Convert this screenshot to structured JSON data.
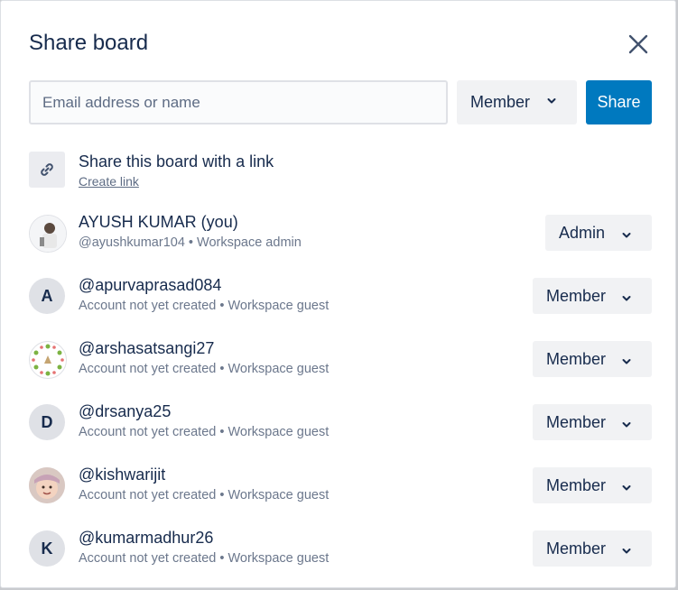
{
  "dialog": {
    "title": "Share board",
    "email_placeholder": "Email address or name",
    "role_default": "Member",
    "share_label": "Share"
  },
  "link_section": {
    "title": "Share this board with a link",
    "create_link_label": "Create link"
  },
  "members": [
    {
      "name": "AYUSH KUMAR (you)",
      "subtitle": "@ayushkumar104 • Workspace admin",
      "role": "Admin",
      "avatar_type": "photo",
      "initial": ""
    },
    {
      "name": "@apurvaprasad084",
      "subtitle": "Account not yet created • Workspace guest",
      "role": "Member",
      "avatar_type": "initial",
      "initial": "A"
    },
    {
      "name": "@arshasatsangi27",
      "subtitle": "Account not yet created • Workspace guest",
      "role": "Member",
      "avatar_type": "floral",
      "initial": ""
    },
    {
      "name": "@drsanya25",
      "subtitle": "Account not yet created • Workspace guest",
      "role": "Member",
      "avatar_type": "initial",
      "initial": "D"
    },
    {
      "name": "@kishwarijit",
      "subtitle": "Account not yet created • Workspace guest",
      "role": "Member",
      "avatar_type": "photo-child",
      "initial": ""
    },
    {
      "name": "@kumarmadhur26",
      "subtitle": "Account not yet created • Workspace guest",
      "role": "Member",
      "avatar_type": "initial",
      "initial": "K"
    }
  ],
  "colors": {
    "primary": "#0079bf",
    "text": "#172b4d",
    "subtext": "#6b778c",
    "button_bg": "#f1f2f4"
  },
  "icons": {
    "close": "close-icon",
    "chevron": "chevron-down-icon",
    "link": "link-icon"
  }
}
